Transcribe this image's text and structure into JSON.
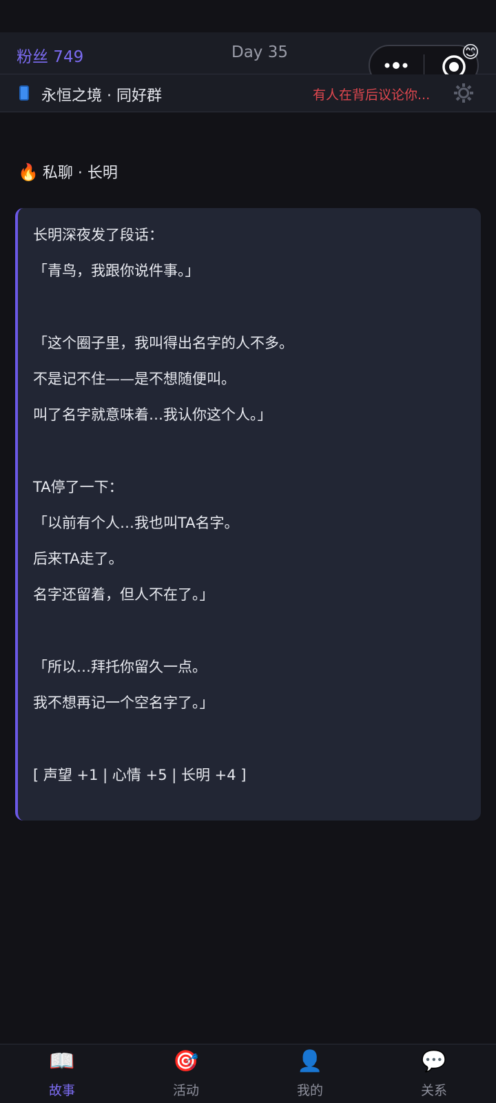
{
  "topbar": {
    "fans": "粉丝 749",
    "day": "Day 35"
  },
  "capsule": {
    "more_icon": "more-dots-icon",
    "close_icon": "target-close-icon",
    "badge_emoji": "😊"
  },
  "subbar": {
    "group_icon": "phone-icon",
    "group_name": "永恒之境 · 同好群",
    "alert": "有人在背后议论你...",
    "settings_icon": "gear-icon"
  },
  "chat": {
    "header_icon": "🔥",
    "header": "私聊 · 长明",
    "lines": [
      "长明深夜发了段话：",
      "「青鸟，我跟你说件事。」",
      "",
      "「这个圈子里，我叫得出名字的人不多。",
      "不是记不住——是不想随便叫。",
      "叫了名字就意味着…我认你这个人。」",
      "",
      "TA停了一下：",
      "「以前有个人…我也叫TA名字。",
      "后来TA走了。",
      "名字还留着，但人不在了。」",
      "",
      "「所以…拜托你留久一点。",
      "我不想再记一个空名字了。」",
      "",
      "[ 声望 +1 | 心情 +5 | 长明 +4 ]"
    ]
  },
  "tabs": [
    {
      "icon": "📖",
      "label": "故事",
      "active": true
    },
    {
      "icon": "🎯",
      "label": "活动",
      "active": false
    },
    {
      "icon": "👤",
      "label": "我的",
      "active": false
    },
    {
      "icon": "💬",
      "label": "关系",
      "active": false
    }
  ],
  "colors": {
    "accent": "#7c6cf2",
    "alert": "#e0484f",
    "background": "#121217",
    "card": "#222634"
  }
}
